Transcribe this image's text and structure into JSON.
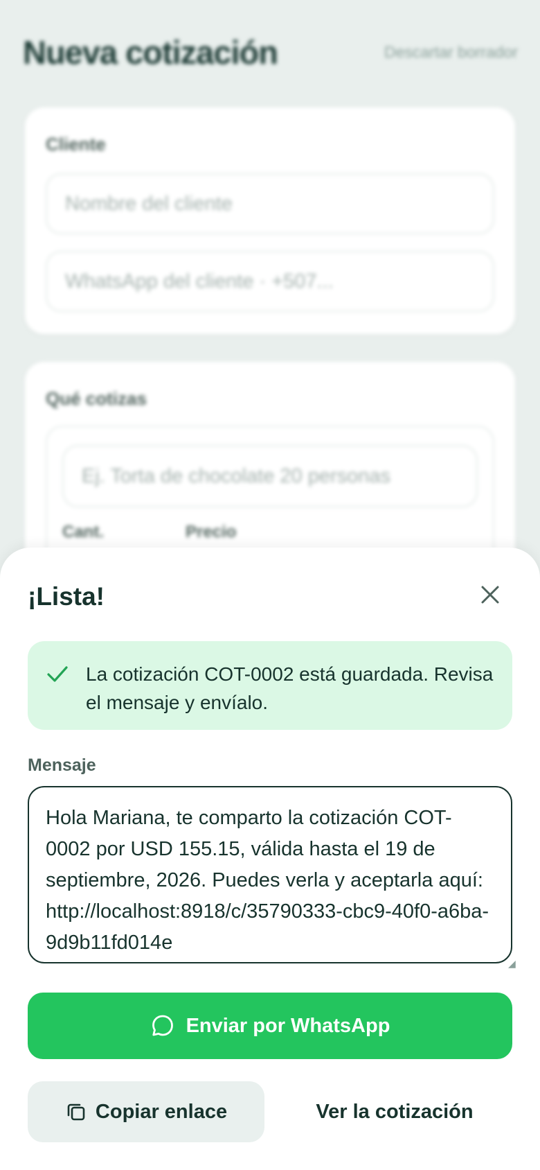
{
  "page": {
    "title": "Nueva cotización",
    "discard_label": "Descartar borrador"
  },
  "client_card": {
    "label": "Cliente",
    "name_placeholder": "Nombre del cliente",
    "whatsapp_placeholder": "WhatsApp del cliente · +507..."
  },
  "items_card": {
    "label": "Qué cotizas",
    "item_placeholder": "Ej. Torta de chocolate 20 personas",
    "qty_label": "Cant.",
    "price_label": "Precio"
  },
  "sheet": {
    "title": "¡Lista!",
    "close_icon": "close-icon",
    "success": {
      "icon": "check-icon",
      "text": "La cotización COT-0002 está guardada. Revisa el mensaje y envíalo."
    },
    "message_label": "Mensaje",
    "message_value": "Hola Mariana, te comparto la cotización COT-0002 por USD 155.15, válida hasta el 19 de septiembre, 2026. Puedes verla y aceptarla aquí: http://localhost:8918/c/35790333-cbc9-40f0-a6ba-9d9b11fd014e",
    "whatsapp_button": "Enviar por WhatsApp",
    "copy_button": "Copiar enlace",
    "view_link": "Ver la cotización"
  },
  "colors": {
    "brand_green": "#23c55e",
    "success_bg": "#dbf8e5",
    "text_dark": "#17332d",
    "page_bg": "#e9efed"
  }
}
